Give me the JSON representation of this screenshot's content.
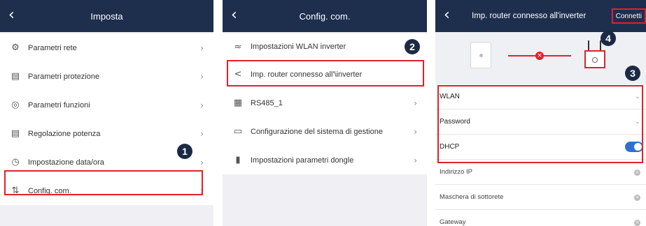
{
  "panel1": {
    "title": "Imposta",
    "items": [
      {
        "icon": "parameters-icon",
        "label": "Parametri rete"
      },
      {
        "icon": "protection-icon",
        "label": "Parametri protezione"
      },
      {
        "icon": "functions-icon",
        "label": "Parametri funzioni"
      },
      {
        "icon": "power-regulation-icon",
        "label": "Regolazione potenza"
      },
      {
        "icon": "clock-icon",
        "label": "Impostazione data/ora"
      },
      {
        "icon": "comm-config-icon",
        "label": "Config. com."
      }
    ],
    "badge": "1"
  },
  "panel2": {
    "title": "Config. com.",
    "items": [
      {
        "icon": "wifi-icon",
        "label": "Impostazioni WLAN inverter"
      },
      {
        "icon": "share-icon",
        "label": "Imp. router connesso all'\\inverter"
      },
      {
        "icon": "rs485-icon",
        "label": "RS485_1"
      },
      {
        "icon": "management-system-icon",
        "label": "Configurazione del sistema di gestione"
      },
      {
        "icon": "dongle-icon",
        "label": "Impostazioni parametri dongle"
      }
    ],
    "badge": "2"
  },
  "panel3": {
    "title": "Imp. router connesso all'inverter",
    "connect_label": "Connetti",
    "badge3": "3",
    "badge4": "4",
    "fields": [
      {
        "label": "WLAN"
      },
      {
        "label": "Password"
      },
      {
        "label": "DHCP"
      }
    ],
    "extra_fields": [
      {
        "label": "Indirizzo IP"
      },
      {
        "label": "Maschera di sottorete"
      },
      {
        "label": "Gateway"
      }
    ]
  },
  "colors": {
    "header": "#1e2f4d",
    "highlight": "#e0212a",
    "toggle": "#2f6fd1",
    "badge": "#1b2a44"
  }
}
